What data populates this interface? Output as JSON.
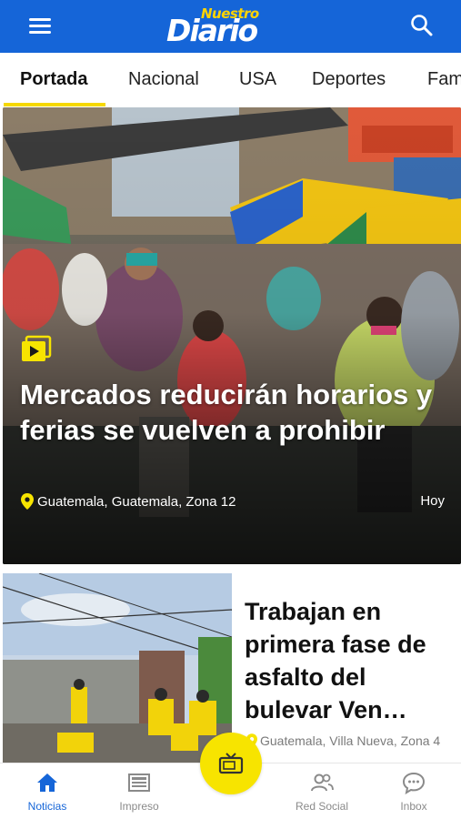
{
  "header": {
    "logo_top": "Nuestro",
    "logo_main": "Diario",
    "menu_icon": "hamburger-menu-icon",
    "search_icon": "search-icon",
    "brand_color": "#1565d8",
    "accent_color": "#f7e400"
  },
  "tabs": [
    {
      "label": "Portada",
      "active": true
    },
    {
      "label": "Nacional",
      "active": false
    },
    {
      "label": "USA",
      "active": false
    },
    {
      "label": "Deportes",
      "active": false
    },
    {
      "label": "Fam",
      "active": false
    }
  ],
  "hero": {
    "title": "Mercados reducirán horarios y ferias se vuelven a prohibir",
    "location": "Guatemala, Guatemala, Zona 12",
    "time": "Hoy",
    "badge_icon": "video-play-icon",
    "image": "market-crowd-photo"
  },
  "card2": {
    "title": "Trabajan en primera fase de asfalto del bulevar Ven…",
    "location": "Guatemala, Villa Nueva, Zona 4",
    "image": "road-workers-photo"
  },
  "bottom_nav": [
    {
      "label": "Noticias",
      "icon": "home-icon",
      "active": true
    },
    {
      "label": "Impreso",
      "icon": "newspaper-icon",
      "active": false
    },
    {
      "label": "Red Social",
      "icon": "users-icon",
      "active": false
    },
    {
      "label": "Inbox",
      "icon": "chat-bubble-icon",
      "active": false
    }
  ],
  "center_button_icon": "tv-icon"
}
